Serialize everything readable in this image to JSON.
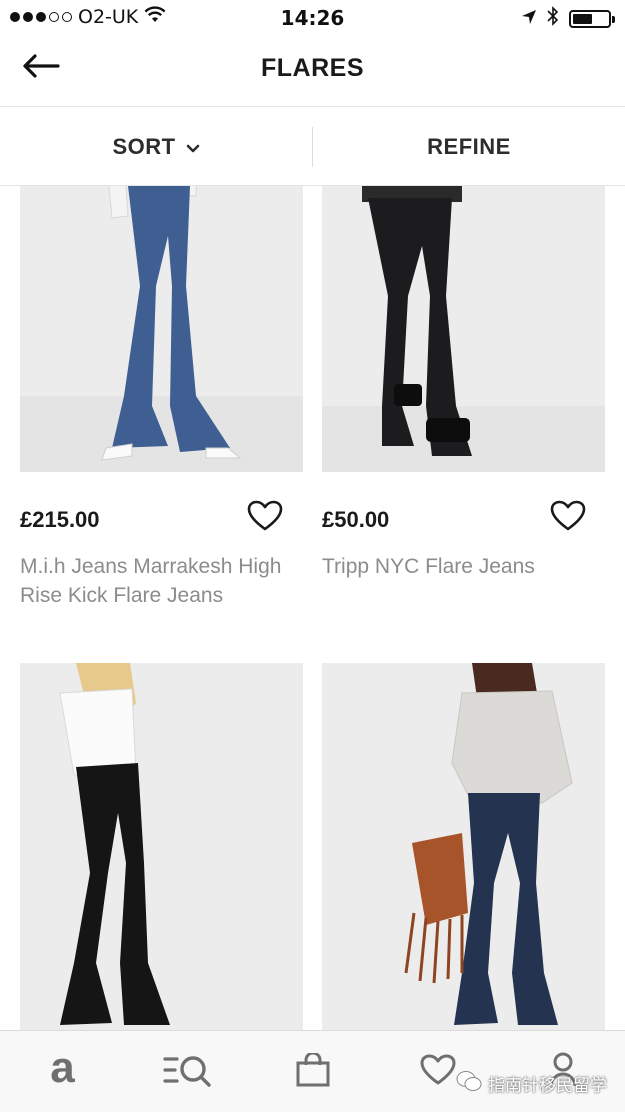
{
  "status_bar": {
    "carrier": "O2-UK",
    "time": "14:26",
    "signal_bars_filled": 3,
    "signal_bars_total": 5,
    "battery_level": 0.55
  },
  "header": {
    "title": "FLARES",
    "back_icon": "arrow-left-icon"
  },
  "filter_bar": {
    "sort_label": "SORT",
    "refine_label": "REFINE"
  },
  "products": [
    {
      "price": "£215.00",
      "name": "M.i.h Jeans Marrakesh High Rise Kick Flare Jeans",
      "jeans_color": "#3f5f93"
    },
    {
      "price": "£50.00",
      "name": "Tripp NYC Flare Jeans",
      "jeans_color": "#1c1c1e"
    },
    {
      "price": "",
      "name": "",
      "jeans_color": "#151515"
    },
    {
      "price": "",
      "name": "",
      "jeans_color": "#233350"
    }
  ],
  "tab_bar": {
    "brand_label": "a",
    "tabs": [
      "home-icon",
      "search-icon",
      "bag-icon",
      "saved-heart-icon",
      "account-icon"
    ]
  },
  "watermark": {
    "text": "指南针移民留学"
  },
  "colors": {
    "text_primary": "#1a1a1a",
    "text_secondary": "#8c8c8c",
    "divider": "#e4e4e4",
    "tab_icon": "#6f6f6f"
  }
}
